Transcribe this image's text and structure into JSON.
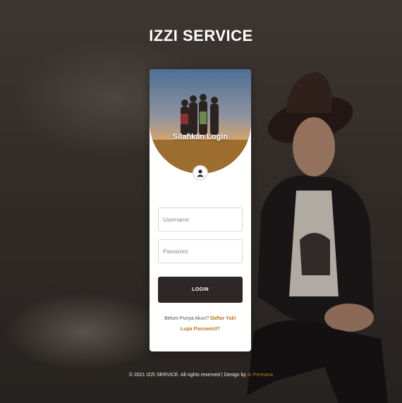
{
  "brand": {
    "title": "IZZI SERVICE"
  },
  "login_card": {
    "heading": "Silahkan Login",
    "username_placeholder": "Username",
    "password_placeholder": "Password",
    "login_label": "LOGIN",
    "signup_prompt": "Belum Punya Akun?",
    "signup_link": "Daftar Yuk!",
    "forgot_link": "Lupa Password?"
  },
  "footer": {
    "text": "© 2021 IZZI SERVICE. All rights reserved | Design by",
    "author": "Ai Permana"
  },
  "colors": {
    "button": "#2e2627",
    "link": "#c0761e",
    "card": "#ffffff"
  },
  "icons": {
    "avatar": "user-icon"
  }
}
